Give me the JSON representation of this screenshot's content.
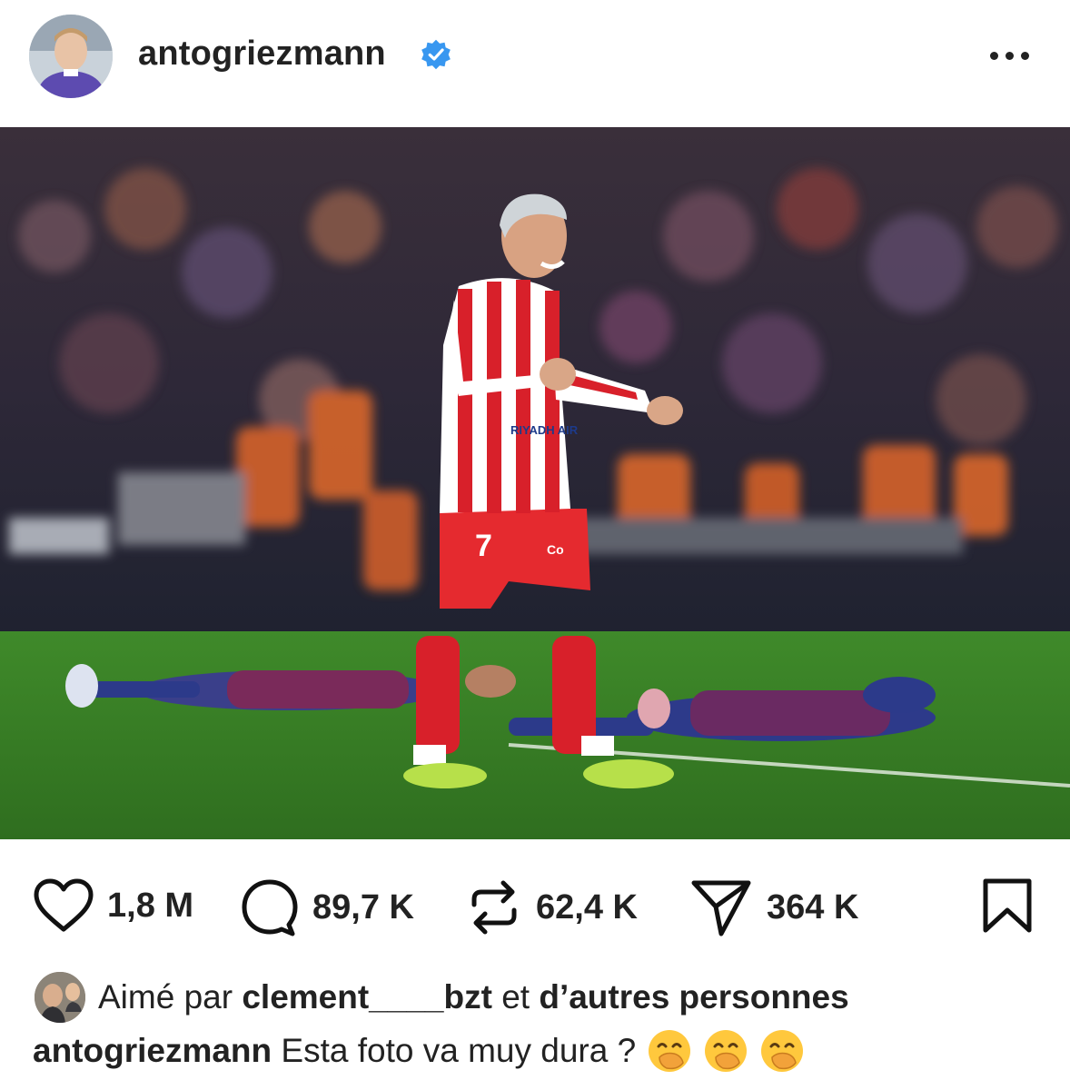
{
  "post": {
    "author": {
      "username": "antogriezmann",
      "verified": true,
      "avatar_icon": "profile-avatar"
    },
    "more_icon": "more-options-icon",
    "image": {
      "description_icon": "post-photo",
      "jersey_number": "7",
      "sponsor_text": "RIYADH AIR",
      "shorts_sponsor": "Co"
    },
    "stats": {
      "likes": "1,8 M",
      "comments": "89,7 K",
      "reposts": "62,4 K",
      "shares": "364 K"
    },
    "liked_by": {
      "prefix": "Aimé par",
      "user": "clement____bzt",
      "middle": "et",
      "others": "d’autres personnes"
    },
    "caption": {
      "username": "antogriezmann",
      "text": "Esta foto va muy dura ?",
      "emojis": [
        "face-with-hand-over-mouth",
        "face-with-hand-over-mouth",
        "face-with-hand-over-mouth"
      ]
    }
  },
  "colors": {
    "verified_blue": "#3897f0",
    "text": "#222222",
    "emoji_yellow": "#ffc83d"
  }
}
